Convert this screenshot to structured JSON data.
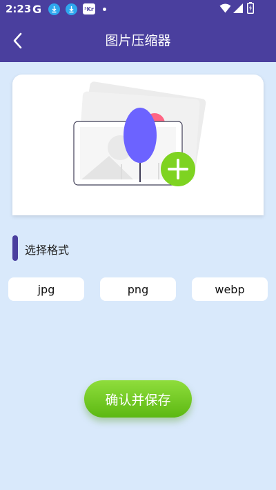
{
  "status_bar": {
    "time": "2:23",
    "icons": [
      "google-icon",
      "download-icon",
      "download-icon",
      "kr-app-icon",
      "dot-icon",
      "wifi-icon",
      "signal-icon",
      "battery-icon"
    ],
    "kr_label": "³Kr"
  },
  "header": {
    "title": "图片压缩器",
    "back_icon": "chevron-left-icon"
  },
  "picker": {
    "icon": "add-image-icon"
  },
  "format_section": {
    "title": "选择格式",
    "options": [
      "jpg",
      "png",
      "webp"
    ]
  },
  "confirm_button": {
    "label": "确认并保存"
  },
  "colors": {
    "primary": "#4a3f9e",
    "background": "#d9e9fb",
    "accent_green": "#7ed321",
    "tree_purple": "#6c63ff",
    "sun_pink": "#ff6584"
  }
}
